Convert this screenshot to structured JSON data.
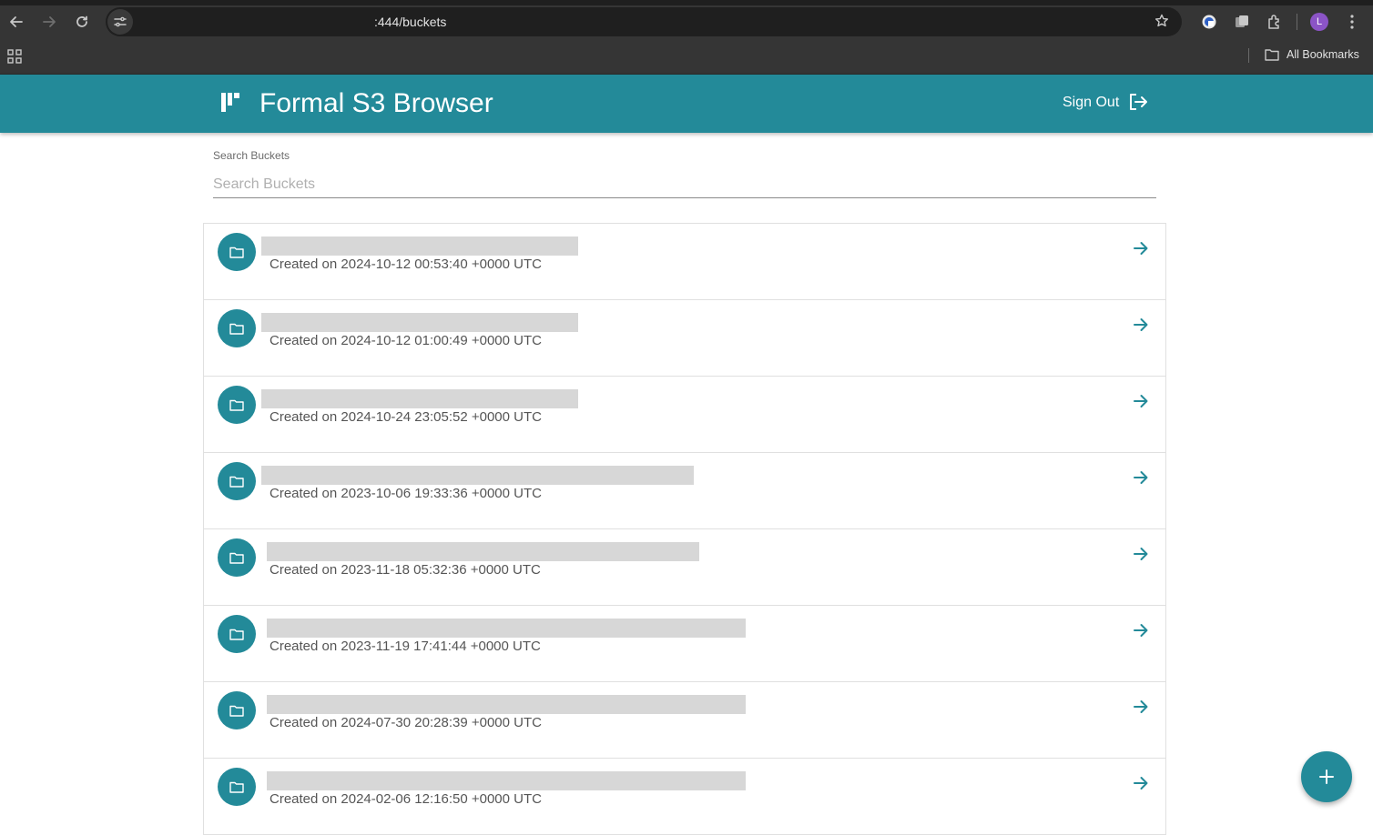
{
  "browser": {
    "url": ":444/buckets",
    "profile_initial": "L",
    "bookmarks_label": "All Bookmarks"
  },
  "app": {
    "title": "Formal S3 Browser",
    "sign_out_label": "Sign Out",
    "accent_color": "#238a99"
  },
  "search": {
    "label": "Search Buckets",
    "placeholder": "Search Buckets",
    "value": ""
  },
  "buckets": [
    {
      "name": "",
      "created": "Created on 2024-10-12 00:53:40 +0000 UTC"
    },
    {
      "name": "",
      "created": "Created on 2024-10-12 01:00:49 +0000 UTC"
    },
    {
      "name": "",
      "created": "Created on 2024-10-24 23:05:52 +0000 UTC"
    },
    {
      "name": "",
      "created": "Created on 2023-10-06 19:33:36 +0000 UTC"
    },
    {
      "name": "",
      "created": "Created on 2023-11-18 05:32:36 +0000 UTC"
    },
    {
      "name": "",
      "created": "Created on 2023-11-19 17:41:44 +0000 UTC"
    },
    {
      "name": "",
      "created": "Created on 2024-07-30 20:28:39 +0000 UTC"
    },
    {
      "name": "",
      "created": "Created on 2024-02-06 12:16:50 +0000 UTC"
    }
  ],
  "icons": {
    "row_icon": "folder-icon",
    "row_action": "arrow-right-icon",
    "fab": "plus-icon"
  }
}
